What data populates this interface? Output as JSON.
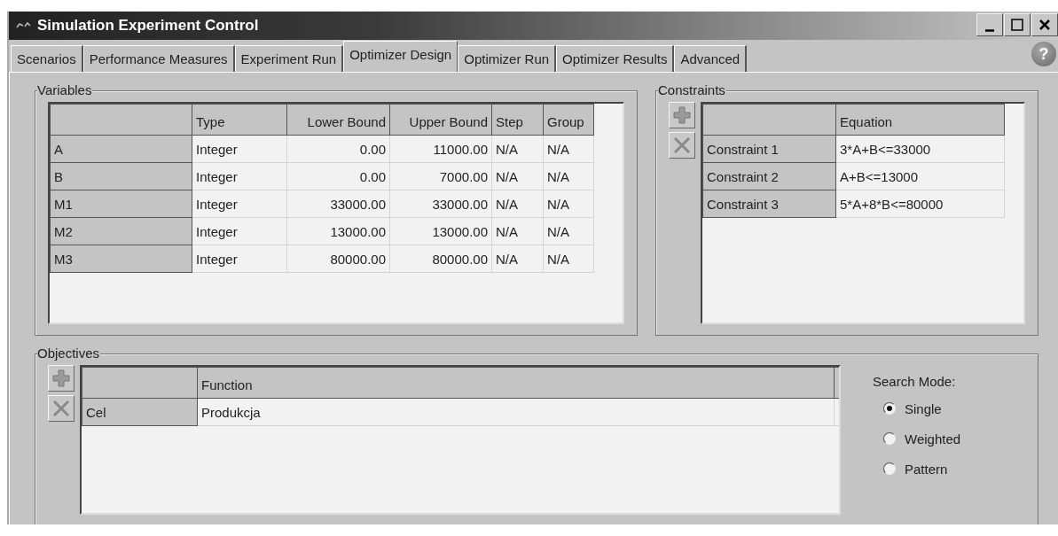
{
  "window": {
    "title": "Simulation Experiment Control"
  },
  "tabs": [
    {
      "label": "Scenarios",
      "selected": false
    },
    {
      "label": "Performance Measures",
      "selected": false
    },
    {
      "label": "Experiment Run",
      "selected": false
    },
    {
      "label": "Optimizer Design",
      "selected": true
    },
    {
      "label": "Optimizer Run",
      "selected": false
    },
    {
      "label": "Optimizer Results",
      "selected": false
    },
    {
      "label": "Advanced",
      "selected": false
    }
  ],
  "help_button": "?",
  "variables": {
    "title": "Variables",
    "columns": [
      {
        "label": "Type",
        "numeric": false
      },
      {
        "label": "Lower Bound",
        "numeric": true
      },
      {
        "label": "Upper Bound",
        "numeric": true
      },
      {
        "label": "Step",
        "numeric": false
      },
      {
        "label": "Group",
        "numeric": false
      }
    ],
    "rows": [
      {
        "name": "A",
        "cells": [
          "Integer",
          "0.00",
          "11000.00",
          "N/A",
          "N/A"
        ]
      },
      {
        "name": "B",
        "cells": [
          "Integer",
          "0.00",
          "7000.00",
          "N/A",
          "N/A"
        ]
      },
      {
        "name": "M1",
        "cells": [
          "Integer",
          "33000.00",
          "33000.00",
          "N/A",
          "N/A"
        ]
      },
      {
        "name": "M2",
        "cells": [
          "Integer",
          "13000.00",
          "13000.00",
          "N/A",
          "N/A"
        ]
      },
      {
        "name": "M3",
        "cells": [
          "Integer",
          "80000.00",
          "80000.00",
          "N/A",
          "N/A"
        ]
      }
    ]
  },
  "constraints": {
    "title": "Constraints",
    "columns": [
      {
        "label": "Equation",
        "numeric": false
      }
    ],
    "rows": [
      {
        "name": "Constraint 1",
        "cells": [
          "3*A+B<=33000"
        ]
      },
      {
        "name": "Constraint 2",
        "cells": [
          "A+B<=13000"
        ]
      },
      {
        "name": "Constraint 3",
        "cells": [
          "5*A+8*B<=80000"
        ]
      }
    ]
  },
  "objectives": {
    "title": "Objectives",
    "columns": [
      {
        "label": "Function",
        "numeric": false
      }
    ],
    "rows": [
      {
        "name": "Cel",
        "cells": [
          "Produkcja"
        ]
      }
    ],
    "search_mode": {
      "label": "Search Mode:",
      "options": [
        {
          "label": "Single",
          "selected": true
        },
        {
          "label": "Weighted",
          "selected": false
        },
        {
          "label": "Pattern",
          "selected": false
        }
      ]
    }
  }
}
